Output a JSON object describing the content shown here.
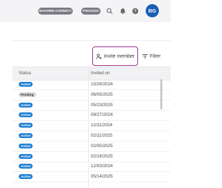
{
  "topbar": {
    "machine_connect": "MACHINE CONNECT",
    "process": "PROCESS",
    "avatar": "BG"
  },
  "toolbar": {
    "invite_label": "Invite member",
    "filter_label": "Filter"
  },
  "table": {
    "columns": [
      "Status",
      "Invited on"
    ],
    "rows": [
      {
        "status": "Active",
        "invited_on": "10/28/2024"
      },
      {
        "status": "Pending",
        "invited_on": "06/05/2025"
      },
      {
        "status": "Active",
        "invited_on": "05/23/2025"
      },
      {
        "status": "Active",
        "invited_on": "09/27/2024"
      },
      {
        "status": "Active",
        "invited_on": "12/11/2024"
      },
      {
        "status": "Active",
        "invited_on": "02/11/2025"
      },
      {
        "status": "Active",
        "invited_on": "02/05/2025"
      },
      {
        "status": "Active",
        "invited_on": "02/18/2025"
      },
      {
        "status": "Active",
        "invited_on": "12/03/2024"
      },
      {
        "status": "Active",
        "invited_on": "05/14/2025"
      }
    ]
  },
  "colors": {
    "accent": "#9a2a8a",
    "active_badge": "#1f7fd4",
    "avatar": "#1a5fb4"
  }
}
